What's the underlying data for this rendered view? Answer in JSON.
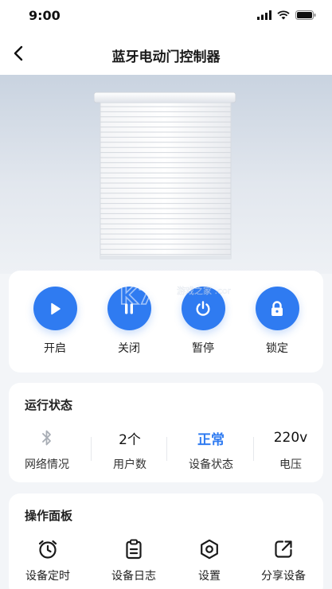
{
  "status_bar": {
    "time": "9:00"
  },
  "nav": {
    "title": "蓝牙电动门控制器"
  },
  "controls": [
    {
      "label": "开启",
      "icon": "play-icon"
    },
    {
      "label": "关闭",
      "icon": "pause-icon"
    },
    {
      "label": "暂停",
      "icon": "power-icon"
    },
    {
      "label": "锁定",
      "icon": "lock-icon"
    }
  ],
  "status": {
    "title": "运行状态",
    "items": [
      {
        "value": "",
        "icon": "bluetooth-icon",
        "label": "网络情况"
      },
      {
        "value": "2个",
        "label": "用户数"
      },
      {
        "value": "正常",
        "label": "设备状态"
      },
      {
        "value": "220v",
        "label": "电压"
      }
    ]
  },
  "panel": {
    "title": "操作面板",
    "items": [
      {
        "label": "设备定时",
        "icon": "alarm-clock-icon"
      },
      {
        "label": "设备日志",
        "icon": "clipboard-icon"
      },
      {
        "label": "设置",
        "icon": "settings-hexagon-icon"
      },
      {
        "label": "分享设备",
        "icon": "share-icon"
      }
    ]
  },
  "watermark": {
    "text": "游戏之家 .com",
    "logo": "K73"
  },
  "colors": {
    "accent": "#2f7bf1",
    "background": "#f3f5f8",
    "card": "#ffffff"
  }
}
